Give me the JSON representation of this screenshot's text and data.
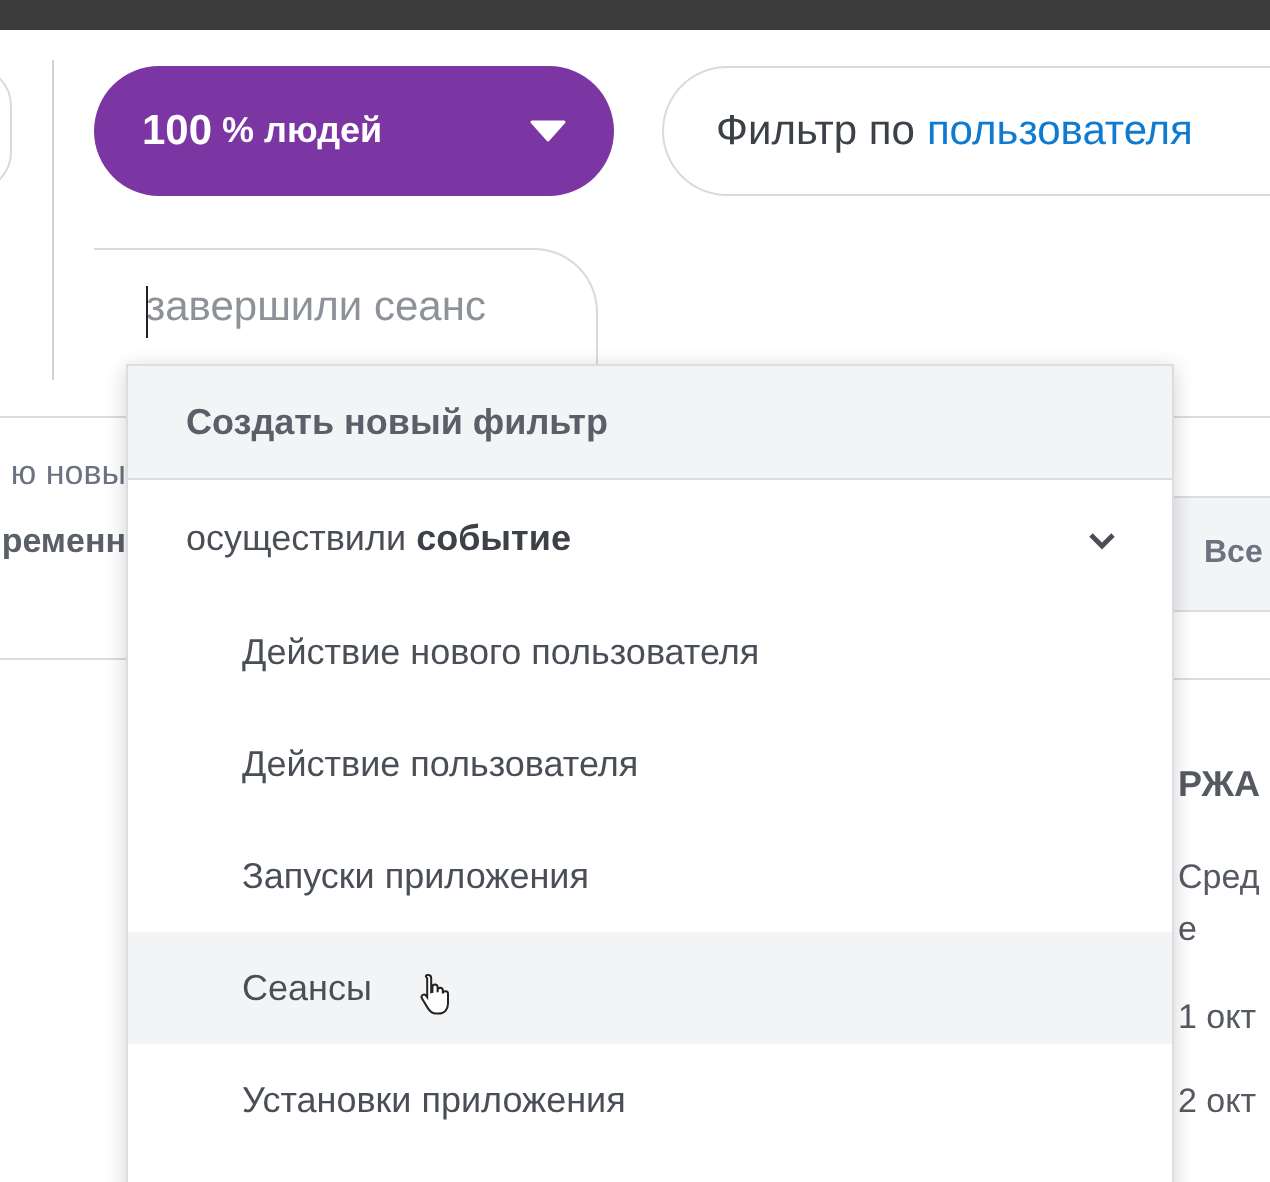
{
  "audience_button": {
    "percent": "100",
    "unit": "% людей"
  },
  "filter_button": {
    "prefix": "Фильтр по",
    "link": "пользователя"
  },
  "search": {
    "placeholder": "завершили сеанс"
  },
  "background": {
    "left_texts": [
      "ю новы",
      "ременн"
    ],
    "column_header": "Все",
    "right_texts": [
      "РЖА",
      "Сред",
      "е",
      "1 окт",
      "2 окт"
    ]
  },
  "menu": {
    "header": "Создать новый фильтр",
    "group": {
      "label": "осуществили **событие**",
      "expanded": true
    },
    "items": [
      {
        "label": "Действие нового пользователя",
        "hovered": false
      },
      {
        "label": "Действие пользователя",
        "hovered": false
      },
      {
        "label": "Запуски приложения",
        "hovered": false
      },
      {
        "label": "Сеансы",
        "hovered": true
      },
      {
        "label": "Установки приложения",
        "hovered": false
      }
    ]
  }
}
